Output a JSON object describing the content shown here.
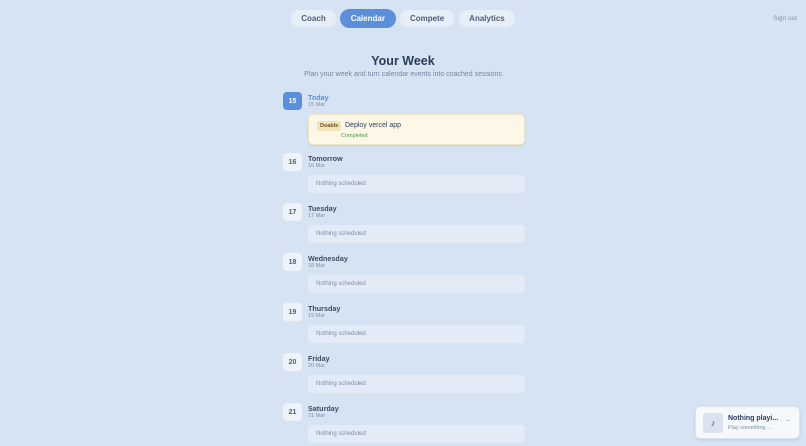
{
  "nav": {
    "tabs": [
      {
        "label": "Coach"
      },
      {
        "label": "Calendar"
      },
      {
        "label": "Compete"
      },
      {
        "label": "Analytics"
      }
    ],
    "active": "Calendar",
    "sign_out": "Sign out"
  },
  "header": {
    "title": "Your Week",
    "subtitle": "Plan your week and turn calendar events into coached sessions"
  },
  "days": [
    {
      "num": "15",
      "name": "Today",
      "date": "15 Mar",
      "task": {
        "tag": "Doable",
        "title": "Deploy vercel app",
        "status": "Completed"
      }
    },
    {
      "num": "16",
      "name": "Tomorrow",
      "date": "16 Mar",
      "empty": "Nothing scheduled"
    },
    {
      "num": "17",
      "name": "Tuesday",
      "date": "17 Mar",
      "empty": "Nothing scheduled"
    },
    {
      "num": "18",
      "name": "Wednesday",
      "date": "18 Mar",
      "empty": "Nothing scheduled"
    },
    {
      "num": "19",
      "name": "Thursday",
      "date": "19 Mar",
      "empty": "Nothing scheduled"
    },
    {
      "num": "20",
      "name": "Friday",
      "date": "20 Mar",
      "empty": "Nothing scheduled"
    },
    {
      "num": "21",
      "name": "Saturday",
      "date": "21 Mar",
      "empty": "Nothing scheduled"
    }
  ],
  "player": {
    "title": "Nothing playi...",
    "subtitle": "Play something ...",
    "art_icon": "music-note-icon",
    "minimize_icon": "minimize-icon"
  },
  "colors": {
    "background": "#d5e3f2",
    "accent": "#5b8fdc",
    "completed": "#4a9a4a",
    "task_card": "#fdf7e8"
  }
}
